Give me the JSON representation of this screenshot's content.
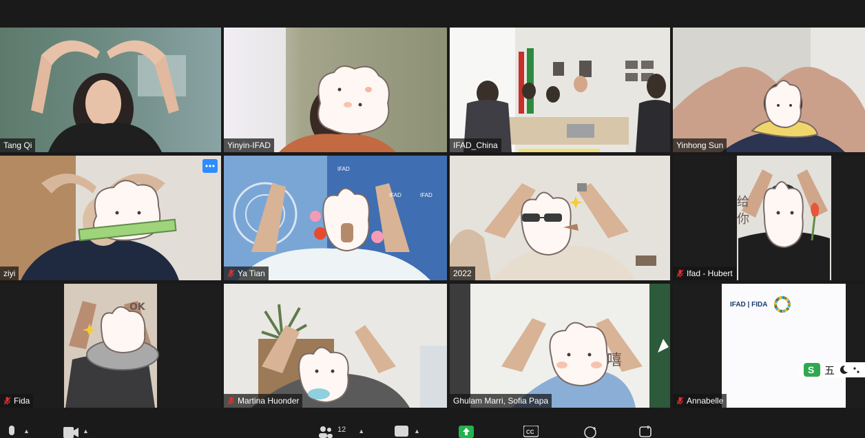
{
  "meeting": {
    "participants": [
      {
        "name": "Tang Qi",
        "muted": false
      },
      {
        "name": "Yinyin-IFAD",
        "muted": false,
        "active_speaker": true
      },
      {
        "name": "IFAD_China",
        "muted": false
      },
      {
        "name": "Yinhong Sun",
        "muted": false
      },
      {
        "name": "ziyi",
        "muted": false,
        "has_menu": true
      },
      {
        "name": "Ya Tian",
        "muted": true
      },
      {
        "name": "2022",
        "muted": false
      },
      {
        "name": "Ifad - Hubert",
        "muted": true
      },
      {
        "name": "Fida",
        "muted": true
      },
      {
        "name": "Martina Huonder",
        "muted": true
      },
      {
        "name": "Ghulam Marri, Sofia Papa",
        "muted": false
      },
      {
        "name": "Annabelle",
        "muted": true
      }
    ],
    "more_icon": "ellipsis-icon",
    "colors": {
      "active_border": "#d8e06a",
      "muted_icon": "#e0312e",
      "menu_button": "#2d8cff",
      "background": "#1a1a1a"
    }
  },
  "slide": {
    "logo_text": "IFAD | FIDA",
    "ime_text": "五"
  },
  "toolbar": {
    "participants_count": "12",
    "items": [
      {
        "icon": "microphone-icon"
      },
      {
        "icon": "video-camera-icon"
      },
      {
        "icon": "participants-icon"
      },
      {
        "icon": "chat-icon"
      },
      {
        "icon": "share-screen-icon"
      },
      {
        "icon": "cc-icon",
        "label": "CC"
      },
      {
        "icon": "reactions-icon"
      },
      {
        "icon": "apps-icon"
      }
    ]
  }
}
